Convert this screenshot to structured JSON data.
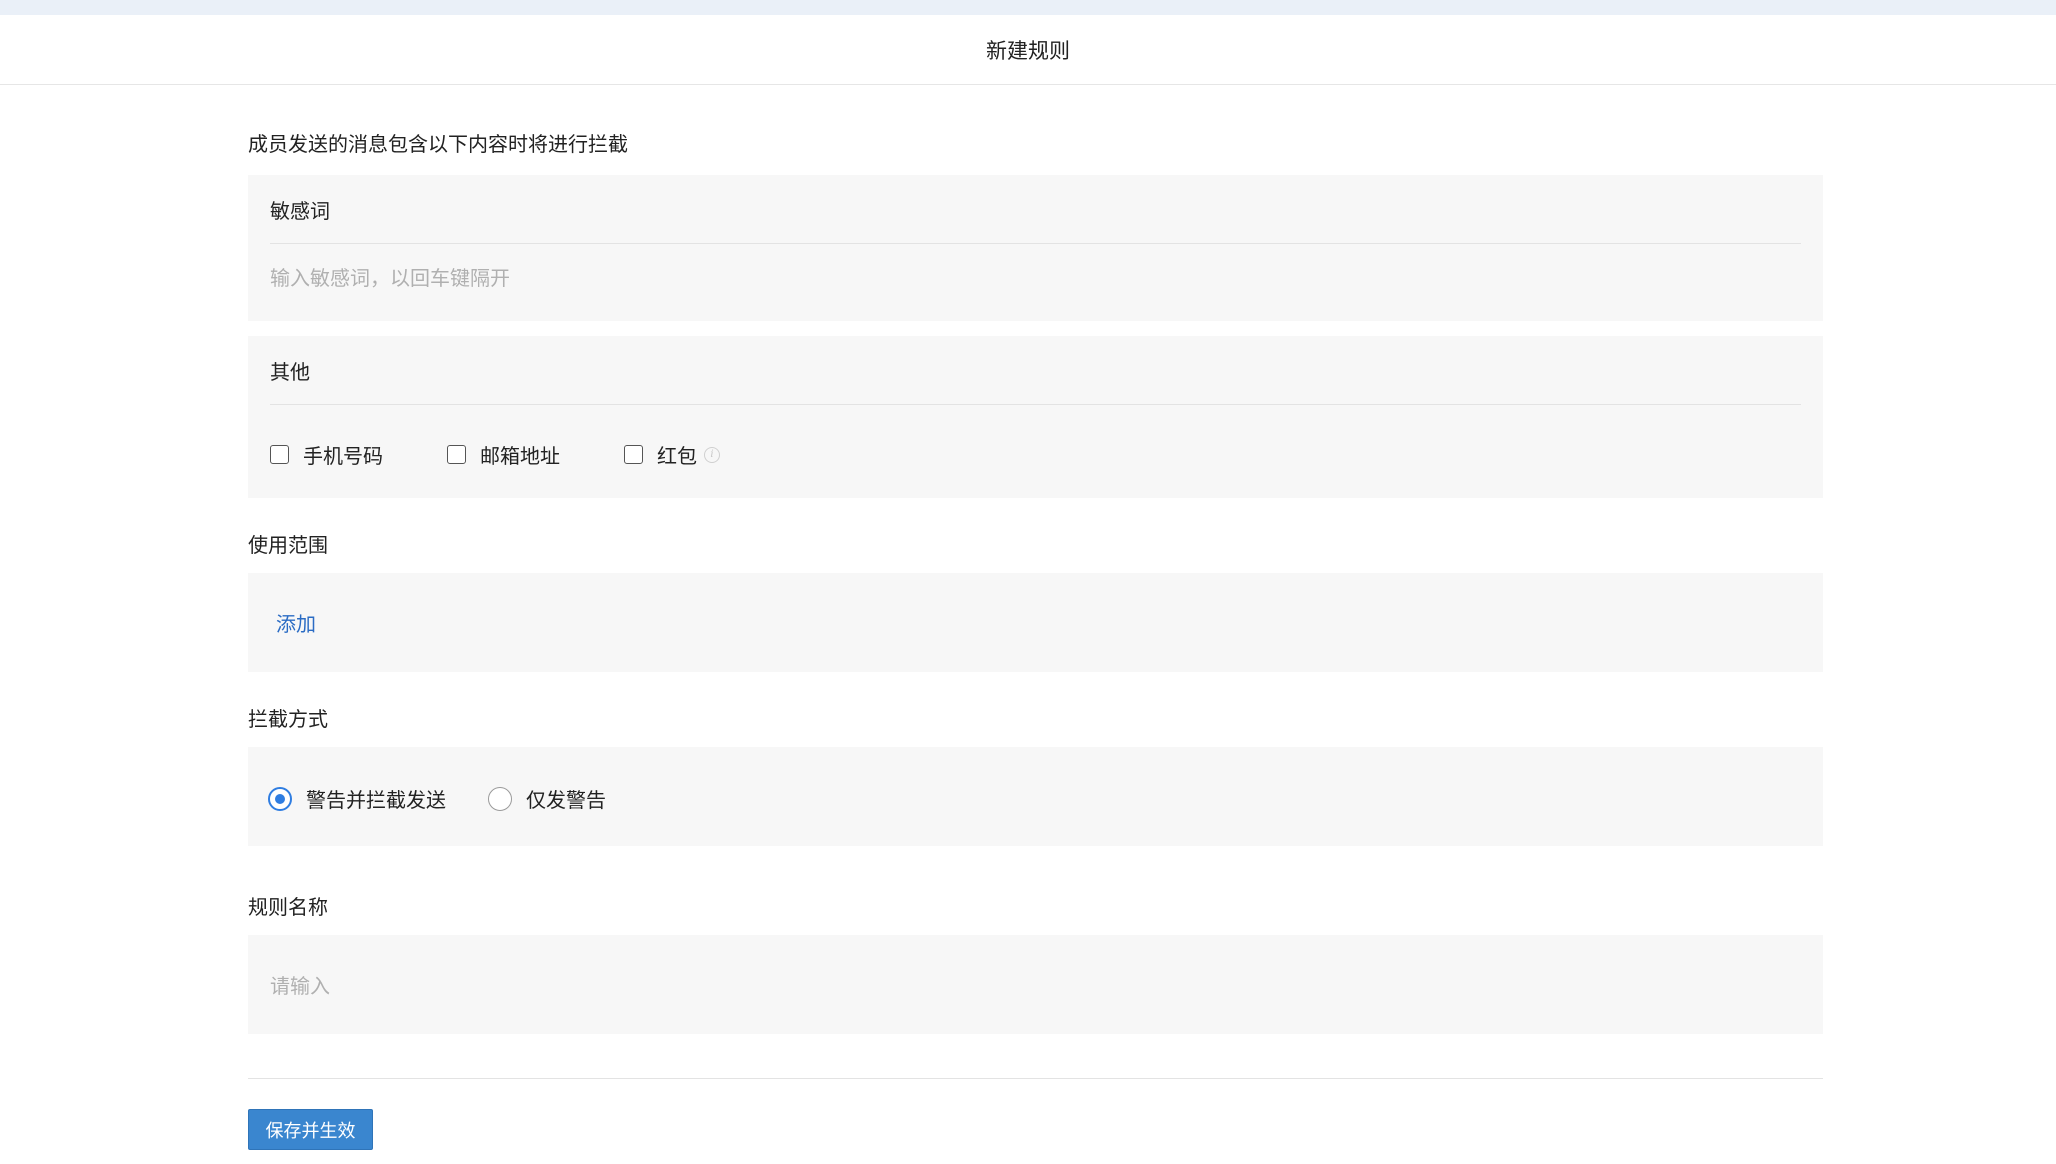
{
  "header": {
    "title": "新建规则"
  },
  "intercept_section": {
    "title": "成员发送的消息包含以下内容时将进行拦截",
    "sensitive_words": {
      "label": "敏感词",
      "placeholder": "输入敏感词，以回车键隔开"
    },
    "other": {
      "label": "其他",
      "options": [
        {
          "label": "手机号码",
          "checked": false
        },
        {
          "label": "邮箱地址",
          "checked": false
        },
        {
          "label": "红包",
          "checked": false,
          "has_info_icon": true
        }
      ]
    }
  },
  "scope_section": {
    "title": "使用范围",
    "add_link": "添加"
  },
  "method_section": {
    "title": "拦截方式",
    "options": [
      {
        "label": "警告并拦截发送",
        "checked": true
      },
      {
        "label": "仅发警告",
        "checked": false
      }
    ]
  },
  "name_section": {
    "title": "规则名称",
    "placeholder": "请输入"
  },
  "footer": {
    "save_button": "保存并生效"
  },
  "colors": {
    "accent": "#2f7de1",
    "link": "#2b6cc4",
    "button": "#3a86cf",
    "panel_bg": "#f7f7f7"
  }
}
